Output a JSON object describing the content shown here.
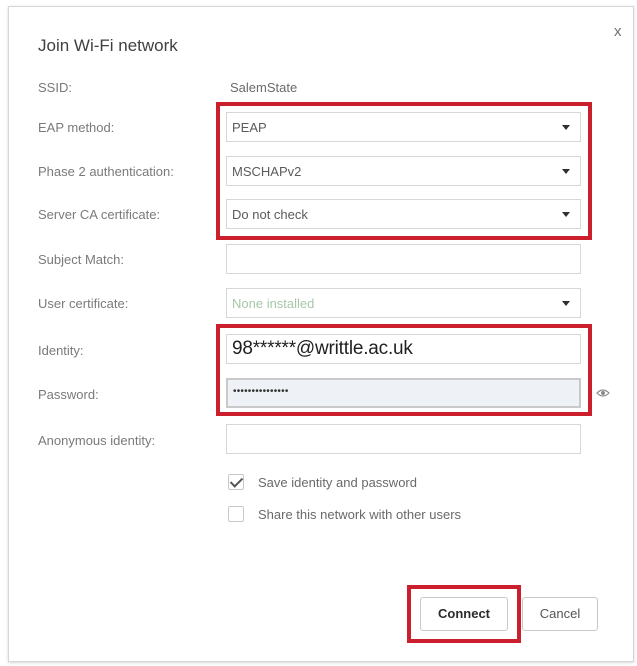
{
  "dialog": {
    "title": "Join Wi-Fi network",
    "close_glyph": "x"
  },
  "form": {
    "ssid": {
      "label": "SSID:",
      "value": "SalemState"
    },
    "eap_method": {
      "label": "EAP method:",
      "value": "PEAP"
    },
    "phase2_auth": {
      "label": "Phase 2 authentication:",
      "value": "MSCHAPv2"
    },
    "server_ca": {
      "label": "Server CA certificate:",
      "value": "Do not check"
    },
    "subject_match": {
      "label": "Subject Match:",
      "value": ""
    },
    "user_certificate": {
      "label": "User certificate:",
      "value": "None installed"
    },
    "identity": {
      "label": "Identity:",
      "value": "98******@writtle.ac.uk"
    },
    "password": {
      "label": "Password:",
      "value": "•••••••••••••••"
    },
    "anonymous_identity": {
      "label": "Anonymous identity:",
      "value": ""
    }
  },
  "checkboxes": {
    "save_identity": {
      "label": "Save identity and password",
      "checked": true
    },
    "share_network": {
      "label": "Share this network with other users",
      "checked": false
    }
  },
  "buttons": {
    "connect": "Connect",
    "cancel": "Cancel"
  },
  "icons": {
    "close": "close-icon",
    "password_visibility": "eye-icon",
    "dropdown": "chevron-down-icon"
  },
  "colors": {
    "highlight": "#cc1f2e",
    "password_bg": "#eef1f6"
  }
}
